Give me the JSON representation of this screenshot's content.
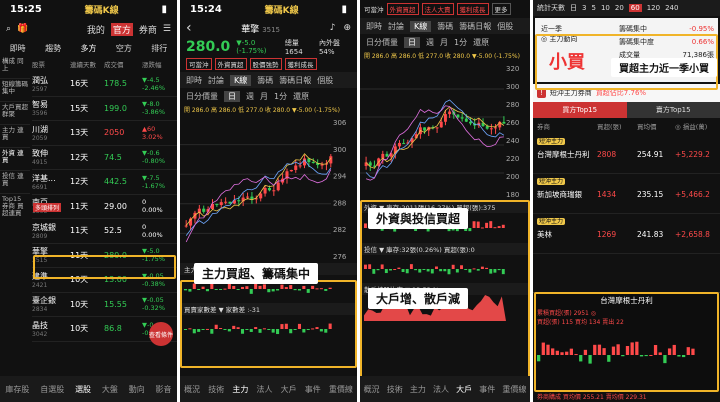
{
  "p1": {
    "time": "15:25",
    "app": "籌碼K線",
    "menu_mine": "我的",
    "menu_official": "官方",
    "menu_bs": "券商",
    "menu_more": "更多",
    "tabs": [
      "即時",
      "趨勢",
      "多方",
      "空方",
      "排行"
    ],
    "side": [
      "構成 同上",
      "短線籌碼 集中",
      "大戶買超 群聚",
      "主力 連買",
      "外資 連買",
      "投信 連買",
      "Top15 券商 買超連買"
    ],
    "col_headers": [
      "股票",
      "連續天數",
      "成交價",
      "漲跌幅"
    ],
    "rows": [
      {
        "name": "潤弘",
        "code": "2597",
        "days": "16天",
        "price": "178.5",
        "chg": "▼-4.5",
        "pct": "-2.46%",
        "c": "grn"
      },
      {
        "name": "智易",
        "code": "3596",
        "days": "15天",
        "price": "199.0",
        "chg": "▼-8.0",
        "pct": "-3.86%",
        "c": "grn"
      },
      {
        "name": "川湖",
        "code": "2059",
        "days": "13天",
        "price": "2050",
        "chg": "▲60",
        "pct": "3.02%",
        "c": "red"
      },
      {
        "name": "致伸",
        "code": "4915",
        "days": "12天",
        "price": "74.5",
        "chg": "▼-0.6",
        "pct": "-0.80%",
        "c": "grn"
      },
      {
        "name": "洋基...",
        "code": "6691",
        "days": "12天",
        "price": "442.5",
        "chg": "▼-7.5",
        "pct": "-1.67%",
        "c": "grn"
      },
      {
        "name": "南亞",
        "code": "1303",
        "days": "11天",
        "price": "29.00",
        "chg": "0",
        "pct": "0.00%",
        "c": "wht"
      },
      {
        "name": "京城銀",
        "code": "2809",
        "days": "11天",
        "price": "52.5",
        "chg": "0",
        "pct": "0.00%",
        "c": "wht"
      },
      {
        "name": "華擎",
        "code": "3515",
        "days": "11天",
        "price": "280.0",
        "chg": "▼-5.0",
        "pct": "-1.75%",
        "c": "grn"
      },
      {
        "name": "建準",
        "code": "2421",
        "days": "10天",
        "price": "13.00",
        "chg": "▼-0.05",
        "pct": "-0.38%",
        "c": "grn"
      },
      {
        "name": "臺企銀",
        "code": "2834",
        "days": "10天",
        "price": "15.55",
        "chg": "▼-0.05",
        "pct": "-0.32%",
        "c": "grn"
      },
      {
        "name": "晶技",
        "code": "3042",
        "days": "10天",
        "price": "86.8",
        "chg": "▼-0.6",
        "pct": "-0.69%",
        "c": "grn"
      }
    ],
    "tag": "多頭排列",
    "badge": "查看條件",
    "nav": [
      "庫存股",
      "自選股",
      "選股",
      "大盤",
      "動向",
      "影音"
    ]
  },
  "p2": {
    "time": "15:24",
    "app": "籌碼K線",
    "stock": "華擎",
    "code": "3515",
    "price": "280.0",
    "chg": "▼-5.0 (-1.75%)",
    "vol": "總量 1654",
    "inout": "內外盤 54%",
    "tags": [
      "可當沖",
      "外資買超",
      "股價強勢",
      "獲利成長"
    ],
    "tabs": [
      "即時",
      "討論",
      "K線",
      "籌碼",
      "籌碼日報",
      "個股"
    ],
    "period": [
      "日分價量",
      "日",
      "週",
      "月",
      "1分",
      "還原"
    ],
    "ma": "開 286.0 高 286.0 低 277.0 收 280.0 ▼-5.00 (-1.75%)",
    "y": [
      "306",
      "300",
      "294",
      "288",
      "282",
      "276"
    ],
    "ind1": "主力買超 ▼ 主力(張):238 累積買超:-11383張",
    "ind2": "買賣家數差 ▼ 家數差 :-31",
    "caption": "主力買超、籌碼集中",
    "nav": [
      "概況",
      "技術",
      "主力",
      "法人",
      "大戶",
      "事件",
      "重價線"
    ]
  },
  "p3": {
    "top": "可當沖",
    "tags": [
      "外資買超",
      "法人大賣",
      "獲利成長",
      "更多"
    ],
    "tabs": [
      "即時",
      "討論",
      "K線",
      "籌碼",
      "籌碼日報",
      "個股"
    ],
    "period": [
      "日分價量",
      "日",
      "週",
      "月",
      "1分",
      "還原"
    ],
    "ma": "開 286.0 高 286.0 低 277.0 收 280.0 ▼-5.00 (-1.75%)",
    "y": [
      "320",
      "300",
      "280",
      "260",
      "240",
      "220",
      "200",
      "180"
    ],
    "ind1": "外資 ▼ 庫存:2011張(16.27%) 買超(張):375",
    "ind2": "投信 ▼ 庫存:32張(0.26%) 買超(張):0",
    "ind3": "散戶持股比率 ▼ 13.53 %",
    "cap1": "外資與投信買超",
    "cap2": "大戶增、散戶減",
    "nav": [
      "概況",
      "技術",
      "主力",
      "法人",
      "大戶",
      "事件",
      "重價線"
    ]
  },
  "p4": {
    "menu": [
      "統計天數",
      "日"
    ],
    "days": [
      "3",
      "5",
      "10",
      "20",
      "60",
      "120",
      "240"
    ],
    "sel_day": "60",
    "lbl_dir": "近一季",
    "lbl_main": "◎ 主力動向",
    "big": "小買",
    "stats": [
      {
        "k": "籌碼集中",
        "v": "-0.95%"
      },
      {
        "k": "籌碼集中度",
        "v": "0.66%"
      },
      {
        "k": "成交量",
        "v": "71,386張"
      },
      {
        "k": "佔成交比重",
        "v": "57.76%"
      }
    ],
    "caption": "買超主力近一季小買",
    "warn": "短沖主力券商",
    "warn_pct": "買超佔比7.76%",
    "tabs2": [
      "買方Top15",
      "賣方Top15"
    ],
    "hdr": [
      "券商",
      "買超(張)",
      "買均價",
      "◎ 損益(萬)"
    ],
    "brokers": [
      {
        "tag": "短沖主力",
        "name": "台灣摩根士丹利",
        "buy": "2808",
        "avg": "254.91",
        "pl": "+5,229.2"
      },
      {
        "tag": "短沖主力",
        "name": "新加坡商瑞銀",
        "buy": "1434",
        "avg": "235.15",
        "pl": "+5,466.2"
      },
      {
        "tag": "短沖主力",
        "name": "美林",
        "buy": "1269",
        "avg": "241.83",
        "pl": "+2,658.8"
      }
    ],
    "mini_title": "台灣摩根士丹利",
    "mini_info": "累積買超(張) 2951 ◎",
    "mini_info2": "買超(張) 115 買均 134 賣出 22",
    "foot": "券商購成 買均價 255.21 賣均價 229.31"
  }
}
